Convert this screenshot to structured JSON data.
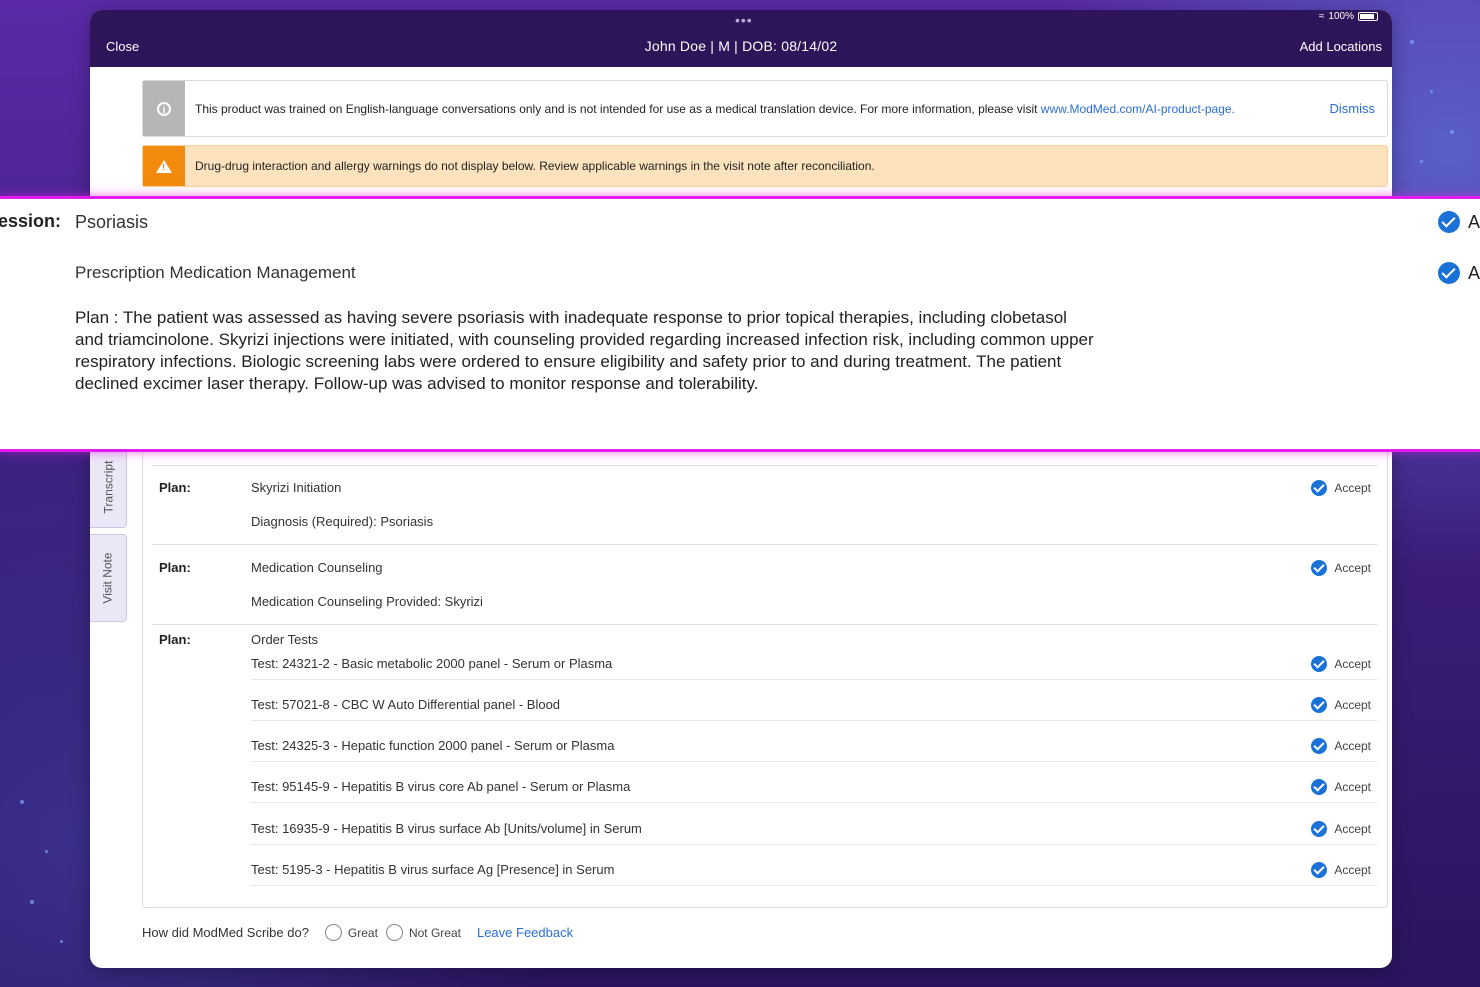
{
  "header": {
    "close_label": "Close",
    "patient_info": "John Doe | M | DOB: 08/14/02",
    "add_locations_label": "Add Locations",
    "battery": "100%"
  },
  "info_banner": {
    "text": "This product was trained on English-language conversations only and is not intended for use as a medical translation device. For more information, please visit ",
    "link": "www.ModMed.com/AI-product-page.",
    "dismiss_label": "Dismiss"
  },
  "warning_banner": {
    "text": "Drug-drug interaction and allergy warnings do not display below. Review applicable warnings in the visit note after reconciliation."
  },
  "side_tabs": {
    "transcript": "Transcript",
    "visit_note": "Visit Note"
  },
  "overlay": {
    "label": "ession:",
    "diagnosis": "Psoriasis",
    "management": "Prescription Medication Management",
    "plan_text": "Plan : The patient was assessed as having severe psoriasis with inadequate response to prior topical therapies, including clobetasol and triamcinolone. Skyrizi injections were initiated, with counseling provided regarding increased infection risk, including common upper respiratory infections. Biologic screening labs were ordered to ensure eligibility and safety prior to and during treatment. The patient declined excimer laser therapy. Follow-up was advised to monitor response and tolerability.",
    "accept_label": "A"
  },
  "plans": [
    {
      "label": "Plan:",
      "title": "Skyrizi Initiation",
      "detail": "Diagnosis (Required): Psoriasis",
      "accept": "Accept"
    },
    {
      "label": "Plan:",
      "title": "Medication Counseling",
      "detail": "Medication Counseling Provided: Skyrizi",
      "accept": "Accept"
    },
    {
      "label": "Plan:",
      "title": "Order Tests"
    }
  ],
  "tests": [
    {
      "text": "Test: 24321-2 - Basic metabolic 2000 panel - Serum or Plasma",
      "accept": "Accept"
    },
    {
      "text": "Test: 57021-8 - CBC W Auto Differential panel - Blood",
      "accept": "Accept"
    },
    {
      "text": "Test: 24325-3 - Hepatic function 2000 panel - Serum or Plasma",
      "accept": "Accept"
    },
    {
      "text": "Test: 95145-9 - Hepatitis B virus core Ab panel - Serum or Plasma",
      "accept": "Accept"
    },
    {
      "text": "Test: 16935-9 - Hepatitis B virus surface Ab [Units/volume] in Serum",
      "accept": "Accept"
    },
    {
      "text": "Test: 5195-3 - Hepatitis B virus surface Ag [Presence] in Serum",
      "accept": "Accept"
    }
  ],
  "feedback": {
    "question": "How did ModMed Scribe do?",
    "option_great": "Great",
    "option_not_great": "Not Great",
    "leave_feedback": "Leave Feedback"
  },
  "colors": {
    "accent_blue": "#1b72d6",
    "header_purple": "#2e1458",
    "warning_orange": "#f28a0e",
    "overlay_magenta": "#e21cf0"
  }
}
